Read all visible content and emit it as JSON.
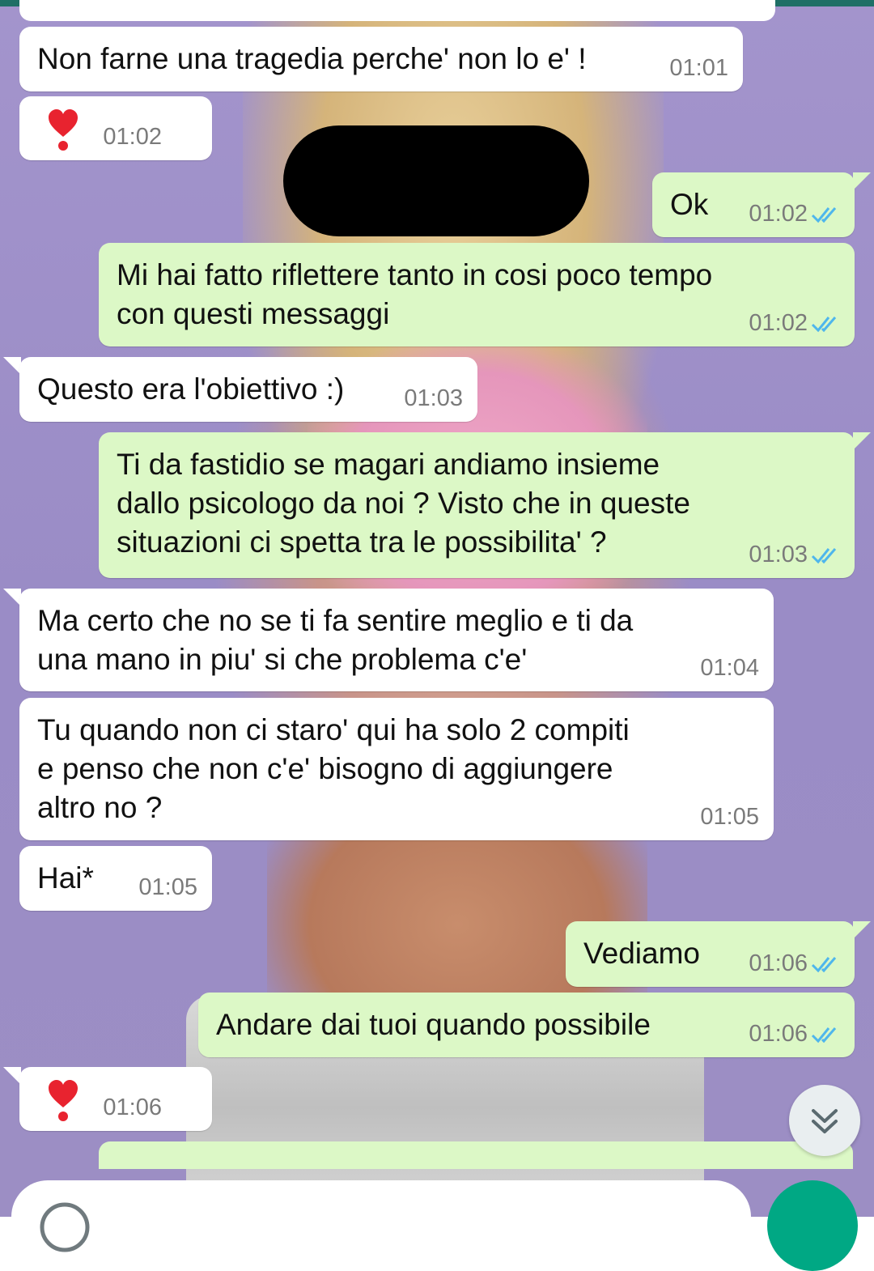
{
  "messages": [
    {
      "text": "Non farne una tragedia perche' non lo e' !",
      "time": "01:01"
    },
    {
      "time": "01:02",
      "emoji": "heart-exclamation"
    },
    {
      "text": "Ok",
      "time": "01:02",
      "status": "read"
    },
    {
      "text": "Mi hai fatto riflettere tanto in cosi poco tempo\ncon questi messaggi",
      "time": "01:02",
      "status": "read"
    },
    {
      "text": "Questo era l'obiettivo :)",
      "time": "01:03"
    },
    {
      "text": "Ti da fastidio se magari andiamo insieme\ndallo psicologo da noi ? Visto che in queste\nsituazioni ci spetta tra le possibilita' ?",
      "time": "01:03",
      "status": "read"
    },
    {
      "text": "Ma certo che no se ti fa sentire meglio e ti da\nuna mano in piu' si che problema c'e'",
      "time": "01:04"
    },
    {
      "text": "Tu quando non ci staro' qui ha solo 2 compiti\ne penso che non c'e' bisogno di aggiungere\naltro no ?",
      "time": "01:05"
    },
    {
      "text": "Hai*",
      "time": "01:05"
    },
    {
      "text": "Vediamo",
      "time": "01:06",
      "status": "read"
    },
    {
      "text": "Andare dai tuoi quando possibile",
      "time": "01:06",
      "status": "read"
    },
    {
      "time": "01:06",
      "emoji": "heart-exclamation"
    }
  ],
  "colors": {
    "incoming": "#ffffff",
    "outgoing": "#dcf8c6",
    "read_ticks": "#4fb6ec",
    "send_button": "#00a884"
  },
  "icons": {
    "scroll_down": "chevron-double-down-icon",
    "send": "mic-icon"
  }
}
